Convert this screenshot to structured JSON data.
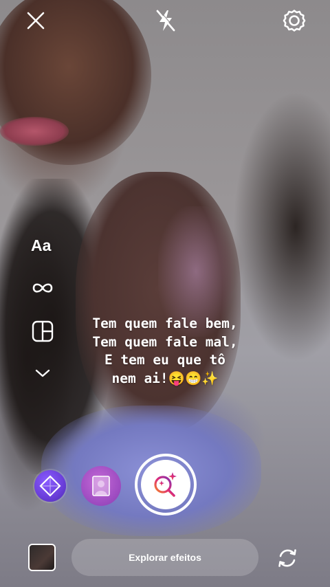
{
  "top_bar": {
    "close_icon": "close-icon",
    "flash_icon": "flash-off-icon",
    "settings_icon": "gear-icon"
  },
  "tools": {
    "text_label": "Aa",
    "boomerang_icon": "infinity-icon",
    "layout_icon": "layout-grid-icon",
    "more_icon": "chevron-down-icon"
  },
  "caption": {
    "lines": [
      "Tem quem fale bem,",
      "Tem quem fale mal,",
      "E tem eu que tô",
      "nem ai!😝😁✨"
    ]
  },
  "effects": {
    "items": [
      "prism-effect-icon",
      "portrait-effect-icon"
    ],
    "capture_icon": "search-sparkle-icon"
  },
  "bottom_bar": {
    "explore_label": "Explorar efeitos",
    "gallery_icon": "gallery-thumbnail",
    "flip_icon": "camera-flip-icon"
  },
  "colors": {
    "accent_gradient_start": "#f58529",
    "accent_gradient_end": "#dd2a7b",
    "icon": "#ffffff"
  }
}
